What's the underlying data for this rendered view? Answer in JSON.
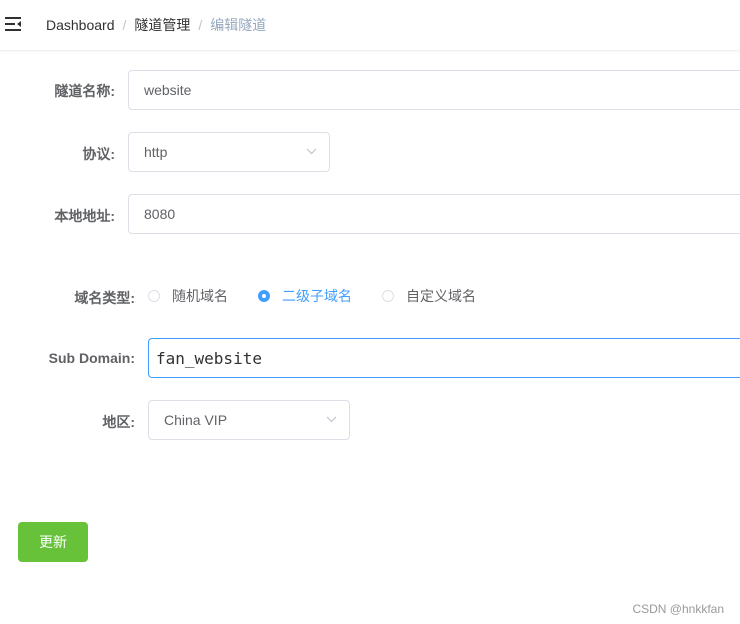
{
  "breadcrumb": {
    "items": [
      "Dashboard",
      "隧道管理",
      "编辑隧道"
    ],
    "separator": "/"
  },
  "form": {
    "tunnel_name": {
      "label": "隧道名称:",
      "value": "website"
    },
    "protocol": {
      "label": "协议:",
      "value": "http"
    },
    "local_address": {
      "label": "本地地址:",
      "value": "8080"
    },
    "domain_type": {
      "label": "域名类型:",
      "options": [
        "随机域名",
        "二级子域名",
        "自定义域名"
      ],
      "selected": "二级子域名"
    },
    "sub_domain": {
      "label": "Sub Domain:",
      "value": "fan_website"
    },
    "region": {
      "label": "地区:",
      "value": "China VIP"
    },
    "update_button": "更新"
  },
  "watermark": "CSDN @hnkkfan",
  "colors": {
    "primary": "#409eff",
    "success": "#67c23a",
    "border": "#dcdfe6"
  }
}
